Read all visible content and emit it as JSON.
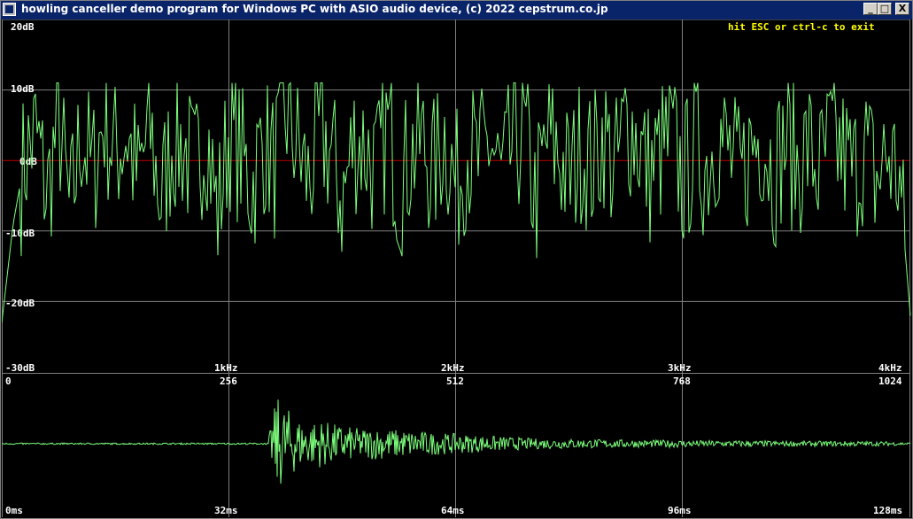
{
  "window": {
    "title": "howling canceller demo program for Windows PC with ASIO audio device, (c) 2022 cepstrum.co.jp",
    "buttons": {
      "minimize": "_",
      "maximize": "□",
      "close": "X"
    }
  },
  "exit_hint": "hit ESC or ctrl-c to exit",
  "colors": {
    "trace": "#7cff7c",
    "grid": "#808080",
    "zero_line": "#c00000",
    "text": "#ffffff",
    "hint": "#ffff00"
  },
  "chart_data": [
    {
      "type": "line",
      "y_tick_labels": [
        "20dB",
        "10dB",
        "0dB",
        "-10dB",
        "-20dB",
        "-30dB"
      ],
      "ylim": [
        -30,
        20
      ],
      "x_tick_labels": [
        "1kHz",
        "2kHz",
        "3kHz",
        "4kHz"
      ],
      "xlim": [
        0,
        4000
      ],
      "x": [
        0,
        50,
        100,
        150,
        200,
        250,
        300,
        350,
        400,
        450,
        500,
        550,
        600,
        650,
        700,
        750,
        800,
        850,
        900,
        950,
        1000,
        1050,
        1100,
        1150,
        1200,
        1250,
        1300,
        1350,
        1400,
        1450,
        1500,
        1550,
        1600,
        1650,
        1700,
        1750,
        1800,
        1850,
        1900,
        1950,
        2000,
        2050,
        2100,
        2150,
        2200,
        2250,
        2300,
        2350,
        2400,
        2450,
        2500,
        2550,
        2600,
        2650,
        2700,
        2750,
        2800,
        2850,
        2900,
        2950,
        3000,
        3050,
        3100,
        3150,
        3200,
        3250,
        3300,
        3350,
        3400,
        3450,
        3500,
        3550,
        3600,
        3650,
        3700,
        3750,
        3800,
        3850,
        3900,
        3950,
        4000
      ],
      "values": [
        -23,
        -9,
        0,
        4,
        -5,
        6,
        -8,
        4,
        -2,
        6,
        1,
        4,
        -3,
        5,
        -6,
        3,
        2,
        -2,
        5,
        -8,
        4,
        1,
        -4,
        3,
        -1,
        7,
        2,
        -3,
        4,
        1,
        -6,
        3,
        2,
        -2,
        5,
        -4,
        1,
        3,
        -2,
        4,
        -4,
        2,
        -1,
        3,
        -3,
        2,
        4,
        -6,
        3,
        1,
        -3,
        2,
        -1,
        4,
        -2,
        6,
        3,
        -2,
        1,
        3,
        -3,
        2,
        -1,
        4,
        1,
        -3,
        2,
        4,
        -2,
        3,
        -1,
        2,
        -2,
        3,
        1,
        -2,
        2,
        -3,
        1,
        -2,
        -22
      ]
    },
    {
      "type": "line",
      "x_tick_labels_top": [
        "0",
        "256",
        "512",
        "768",
        "1024"
      ],
      "x_tick_labels_bottom": [
        "0ms",
        "32ms",
        "64ms",
        "96ms",
        "128ms"
      ],
      "xlim": [
        0,
        1024
      ],
      "ylim": [
        -1,
        1
      ],
      "x": [
        0,
        32,
        64,
        96,
        128,
        160,
        192,
        224,
        256,
        288,
        300,
        310,
        320,
        340,
        360,
        380,
        400,
        420,
        440,
        460,
        480,
        500,
        520,
        540,
        560,
        580,
        600,
        640,
        680,
        720,
        760,
        800,
        840,
        880,
        920,
        960,
        1000,
        1024
      ],
      "values": [
        0,
        0.01,
        -0.01,
        0.01,
        0,
        -0.01,
        0.01,
        0,
        0.01,
        0,
        0.05,
        0.9,
        -0.7,
        0.4,
        -0.45,
        0.35,
        -0.3,
        0.3,
        -0.28,
        0.25,
        -0.22,
        0.2,
        -0.18,
        0.16,
        -0.14,
        0.12,
        -0.1,
        0.09,
        -0.08,
        0.07,
        -0.07,
        0.06,
        -0.06,
        0.05,
        -0.05,
        0.05,
        -0.04,
        0.02
      ]
    }
  ]
}
